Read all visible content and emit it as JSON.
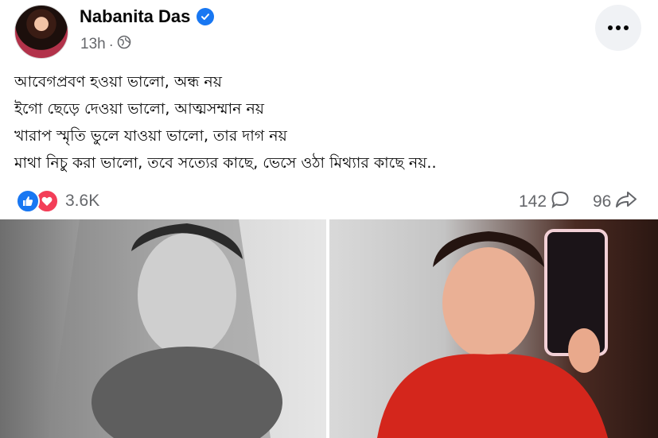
{
  "post": {
    "author": "Nabanita Das",
    "time": "13h",
    "separator": "·",
    "lines": [
      "আবেগপ্রবণ হওয়া ভালো,  অন্ধ নয়",
      "ইগো ছেড়ে দেওয়া ভালো, আত্মসম্মান নয়",
      "খারাপ স্মৃতি ভুলে যাওয়া ভালো,  তার দাগ নয়",
      "মাথা নিচু করা ভালো,  তবে সত্যের কাছে,  ভেসে ওঠা মিথ্যার কাছে নয়.."
    ],
    "reaction_count": "3.6K",
    "comment_count": "142",
    "share_count": "96"
  },
  "icons": {
    "verified": "verified-badge-icon",
    "privacy": "globe-icon",
    "more": "more-options-icon",
    "like": "like-reaction-icon",
    "love": "love-reaction-icon",
    "comment": "comment-icon",
    "share": "share-icon"
  },
  "colors": {
    "brand_blue": "#1877f2",
    "love_red": "#f33e58",
    "secondary_text": "#65676b",
    "button_bg": "#f0f2f5"
  }
}
